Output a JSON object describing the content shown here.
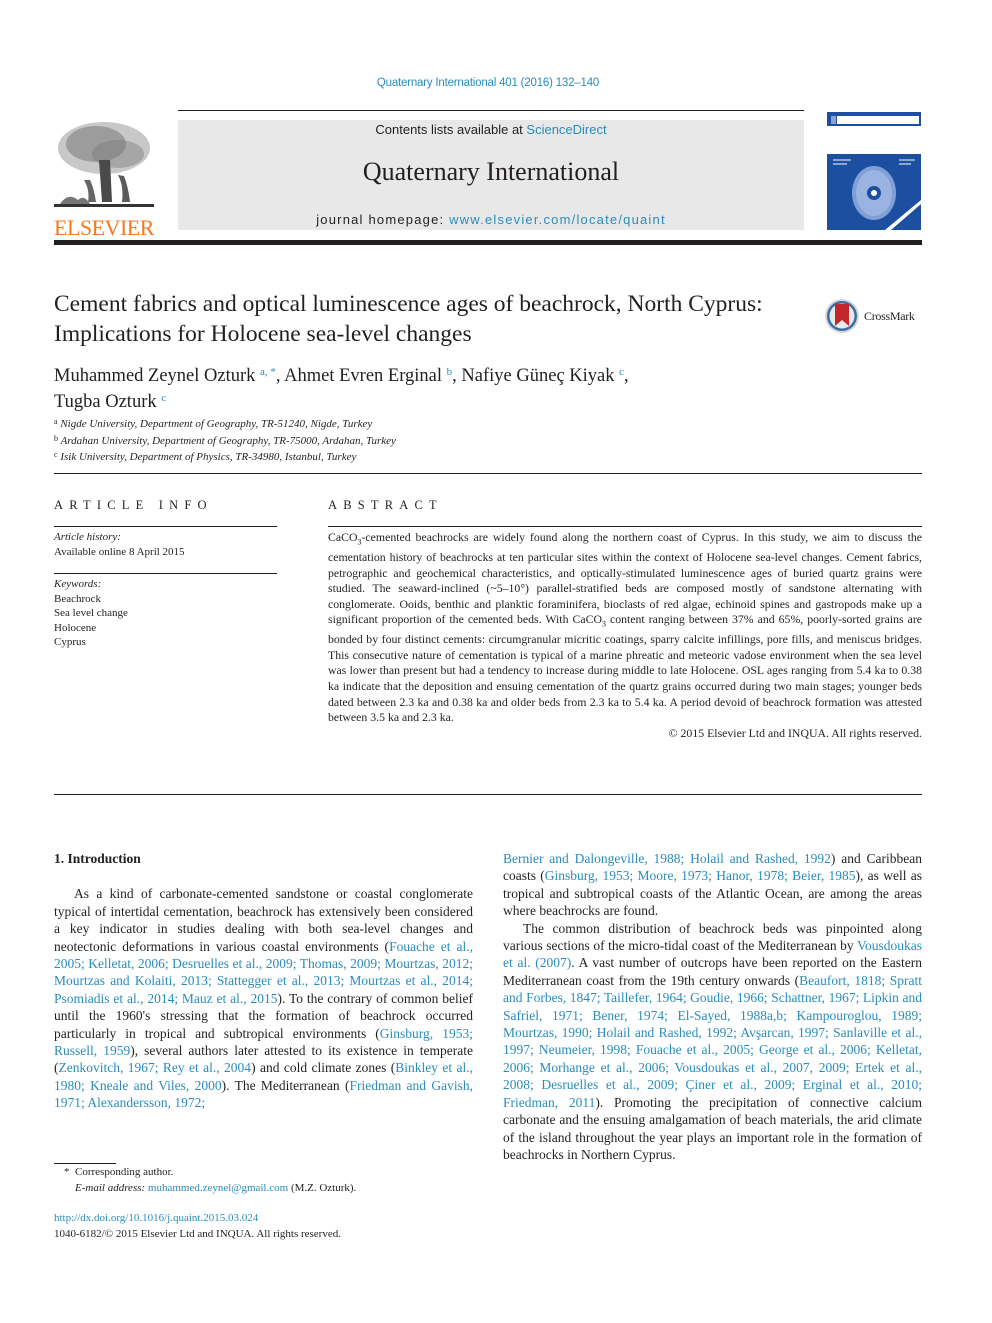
{
  "header": {
    "journal_reference": "Quaternary International 401 (2016) 132–140",
    "contents_prefix": "Contents lists available at ",
    "contents_link": "ScienceDirect",
    "journal_title": "Quaternary International",
    "homepage_prefix": "journal homepage: ",
    "homepage_link": "www.elsevier.com/locate/quaint",
    "publisher_logo": "ELSEVIER",
    "colors": {
      "link": "#2a8cbb",
      "elsevier_orange": "#f47920",
      "cover_blue": "#1c4fa0",
      "masthead_bg": "#e8e8e8"
    }
  },
  "article": {
    "title": "Cement fabrics and optical luminescence ages of beachrock, North Cyprus: Implications for Holocene sea-level changes",
    "crossmark_label": "CrossMark",
    "authors": [
      {
        "name": "Muhammed Zeynel Ozturk",
        "sup": "a, *",
        "sep": ", "
      },
      {
        "name": "Ahmet Evren Erginal",
        "sup": "b",
        "sep": ", "
      },
      {
        "name": "Nafiye Güneç Kiyak",
        "sup": "c",
        "sep": ","
      },
      {
        "name": "Tugba Ozturk",
        "sup": "c",
        "sep": ""
      }
    ],
    "affiliations": [
      {
        "sup": "a",
        "text": "Nigde University, Department of Geography, TR-51240, Nigde, Turkey"
      },
      {
        "sup": "b",
        "text": "Ardahan University, Department of Geography, TR-75000, Ardahan, Turkey"
      },
      {
        "sup": "c",
        "text": "Isik University, Department of Physics, TR-34980, Istanbul, Turkey"
      }
    ]
  },
  "article_info": {
    "heading": "ARTICLE INFO",
    "history_label": "Article history:",
    "history_value": "Available online 8 April 2015",
    "keywords_label": "Keywords:",
    "keywords": [
      "Beachrock",
      "Sea level change",
      "Holocene",
      "Cyprus"
    ]
  },
  "abstract": {
    "heading": "ABSTRACT",
    "part1": "CaCO",
    "sub1": "3",
    "part2": "-cemented beachrocks are widely found along the northern coast of Cyprus. In this study, we aim to discuss the cementation history of beachrocks at ten particular sites within the context of Holocene sea-level changes. Cement fabrics, petrographic and geochemical characteristics, and optically-stimulated luminescence ages of buried quartz grains were studied. The seaward-inclined (~5–10°) parallel-stratified beds are composed mostly of sandstone alternating with conglomerate. Ooids, benthic and planktic foraminifera, bioclasts of red algae, echinoid spines and gastropods make up a significant proportion of the cemented beds. With CaCO",
    "sub2": "3",
    "part3": " content ranging between 37% and 65%, poorly-sorted grains are bonded by four distinct cements: circumgranular micritic coatings, sparry calcite infillings, pore fills, and meniscus bridges. This consecutive nature of cementation is typical of a marine phreatic and meteoric vadose environment when the sea level was lower than present but had a tendency to increase during middle to late Holocene. OSL ages ranging from 5.4 ka to 0.38 ka indicate that the deposition and ensuing cementation of the quartz grains occurred during two main stages; younger beds dated between 2.3 ka and 0.38 ka and older beds from 2.3 ka to 5.4 ka. A period devoid of beachrock formation was attested between 3.5 ka and 2.3 ka.",
    "copyright": "© 2015 Elsevier Ltd and INQUA. All rights reserved."
  },
  "body": {
    "section_title": "1.  Introduction",
    "left_col": [
      {
        "t": "As a kind of carbonate-cemented sandstone or coastal conglomerate typical of intertidal cementation, beachrock has extensively been considered a key indicator in studies dealing with both sea-level changes and neotectonic deformations in various coastal environments ("
      },
      {
        "l": "Fouache et al., 2005; Kelletat, 2006; Desruelles et al., 2009; Thomas, 2009; Mourtzas, 2012; Mourtzas and Kolaiti, 2013; Stattegger et al., 2013; Mourtzas et al., 2014; Psomiadis et al., 2014; Mauz et al., 2015"
      },
      {
        "t": "). To the contrary of common belief until the 1960's stressing that the formation of beachrock occurred particularly in tropical and subtropical environments ("
      },
      {
        "l": "Ginsburg, 1953; Russell, 1959"
      },
      {
        "t": "), several authors later attested to its existence in temperate ("
      },
      {
        "l": "Zenkovitch, 1967; Rey et al., 2004"
      },
      {
        "t": ") and cold climate zones ("
      },
      {
        "l": "Binkley et al., 1980; Kneale and Viles, 2000"
      },
      {
        "t": "). The Mediterranean ("
      },
      {
        "l": "Friedman and Gavish, 1971; Alexandersson, 1972;"
      }
    ],
    "right_col_p1": [
      {
        "l": "Bernier and Dalongeville, 1988; Holail and Rashed, 1992"
      },
      {
        "t": ") and Caribbean coasts ("
      },
      {
        "l": "Ginsburg, 1953; Moore, 1973; Hanor, 1978; Beier, 1985"
      },
      {
        "t": "), as well as tropical and subtropical coasts of the Atlantic Ocean, are among the areas where beachrocks are found."
      }
    ],
    "right_col_p2": [
      {
        "t": "The common distribution of beachrock beds was pinpointed along various sections of the micro-tidal coast of the Mediterranean by "
      },
      {
        "l": "Vousdoukas et al. (2007)"
      },
      {
        "t": ". A vast number of outcrops have been reported on the Eastern Mediterranean coast from the 19th century onwards ("
      },
      {
        "l": "Beaufort, 1818; Spratt and Forbes, 1847; Taillefer, 1964; Goudie, 1966; Schattner, 1967; Lipkin and Safriel, 1971; Bener, 1974; El-Sayed, 1988a,b; Kampouroglou, 1989; Mourtzas, 1990; Holail and Rashed, 1992; Avşarcan, 1997; Sanlaville et al., 1997; Neumeier, 1998; Fouache et al., 2005; George et al., 2006; Kelletat, 2006; Morhange et al., 2006; Vousdoukas et al., 2007, 2009; Ertek et al., 2008; Desruelles et al., 2009; Çiner et al., 2009; Erginal et al., 2010; Friedman, 2011"
      },
      {
        "t": "). Promoting the precipitation of connective calcium carbonate and the ensuing amalgamation of beach materials, the arid climate of the island throughout the year plays an important role in the formation of beachrocks in Northern Cyprus."
      }
    ]
  },
  "footnotes": {
    "corresponding_mark": "*",
    "corresponding_text": "Corresponding author.",
    "email_label": "E-mail address:",
    "email": "muhammed.zeynel@gmail.com",
    "email_suffix": " (M.Z. Ozturk).",
    "doi": "http://dx.doi.org/10.1016/j.quaint.2015.03.024",
    "issn_line": "1040-6182/© 2015 Elsevier Ltd and INQUA. All rights reserved."
  }
}
